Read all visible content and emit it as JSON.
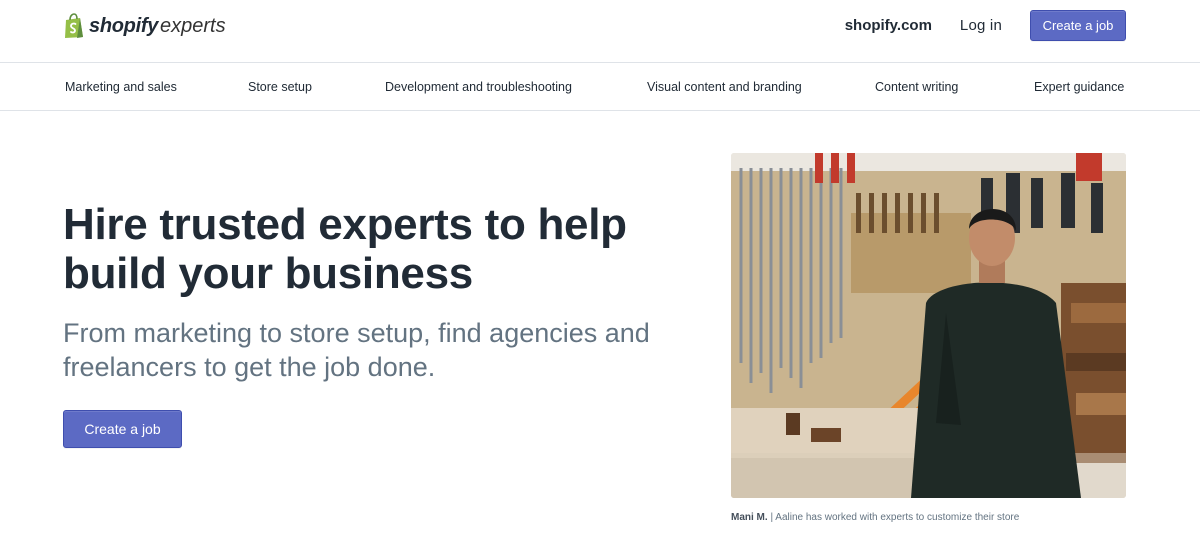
{
  "header": {
    "logo_brand": "shopify",
    "logo_suffix": "experts",
    "shopify_link": "shopify.com",
    "login_link": "Log in",
    "create_job_button": "Create a job"
  },
  "nav": {
    "items": [
      "Marketing and sales",
      "Store setup",
      "Development and troubleshooting",
      "Visual content and branding",
      "Content writing",
      "Expert guidance"
    ]
  },
  "hero": {
    "title": "Hire trusted experts to help build your business",
    "subtitle": "From marketing to store setup, find agencies and freelancers to get the job done.",
    "cta_button": "Create a job"
  },
  "photo": {
    "caption_name": "Mani M.",
    "caption_separator": " | ",
    "caption_text": "Aaline has worked with experts to customize their store"
  },
  "colors": {
    "accent": "#5c6ac4",
    "text_primary": "#212b36",
    "text_secondary": "#637381",
    "logo_green": "#95bf47"
  },
  "icons": [
    "shopify-bag-logo-icon"
  ]
}
